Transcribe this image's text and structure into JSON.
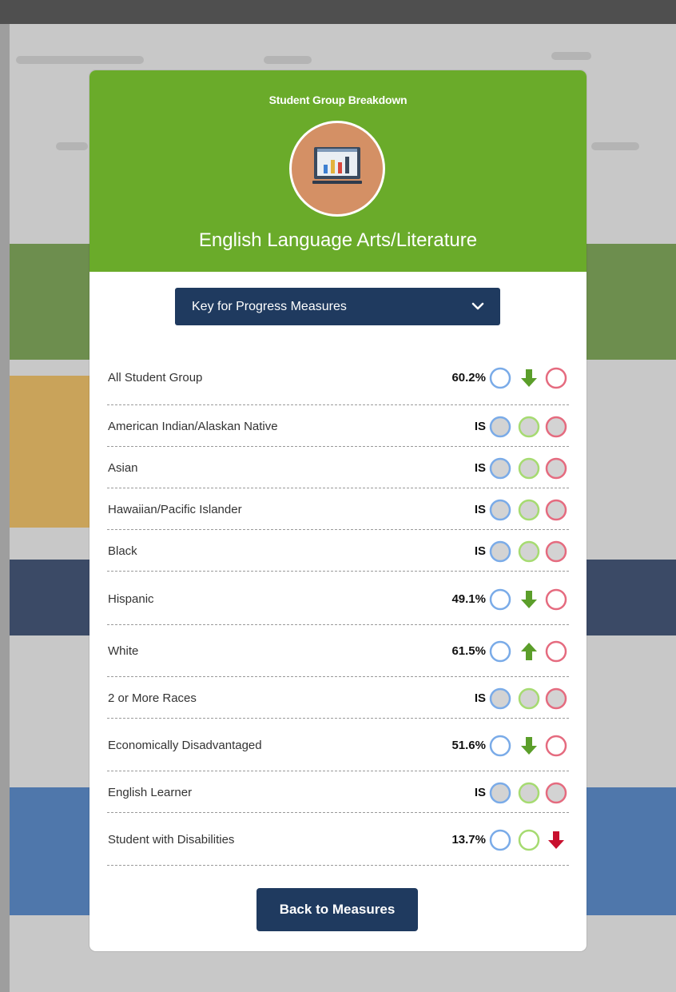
{
  "modal": {
    "title": "Student Group Breakdown",
    "subject": "English Language Arts/Literature",
    "subject_icon": "chart-monitor-icon",
    "key_dropdown_label": "Key for Progress Measures",
    "back_button_label": "Back to Measures"
  },
  "colors": {
    "header_green": "#6aab2a",
    "navy": "#1f3a5f",
    "circle_blue": "#7aabe8",
    "circle_green": "#a6db71",
    "circle_red": "#e56b7f",
    "arrow_green": "#5b9e2a",
    "arrow_red": "#c8102e"
  },
  "groups": [
    {
      "label": "All Student Group",
      "value": "60.2%",
      "indicators": [
        "blue-ring",
        "green-arrow-down",
        "red-ring"
      ]
    },
    {
      "label": "American Indian/Alaskan Native",
      "value": "IS",
      "indicators": [
        "blue-filled",
        "green-filled",
        "red-filled"
      ]
    },
    {
      "label": "Asian",
      "value": "IS",
      "indicators": [
        "blue-filled",
        "green-filled",
        "red-filled"
      ]
    },
    {
      "label": "Hawaiian/Pacific Islander",
      "value": "IS",
      "indicators": [
        "blue-filled",
        "green-filled",
        "red-filled"
      ]
    },
    {
      "label": "Black",
      "value": "IS",
      "indicators": [
        "blue-filled",
        "green-filled",
        "red-filled"
      ]
    },
    {
      "label": "Hispanic",
      "value": "49.1%",
      "indicators": [
        "blue-ring",
        "green-arrow-down",
        "red-ring"
      ]
    },
    {
      "label": "White",
      "value": "61.5%",
      "indicators": [
        "blue-ring",
        "green-arrow-up",
        "red-ring"
      ]
    },
    {
      "label": "2 or More Races",
      "value": "IS",
      "indicators": [
        "blue-filled",
        "green-filled",
        "red-filled"
      ]
    },
    {
      "label": "Economically Disadvantaged",
      "value": "51.6%",
      "indicators": [
        "blue-ring",
        "green-arrow-down",
        "red-ring"
      ]
    },
    {
      "label": "English Learner",
      "value": "IS",
      "indicators": [
        "blue-filled",
        "green-filled",
        "red-filled"
      ]
    },
    {
      "label": "Student with Disabilities",
      "value": "13.7%",
      "indicators": [
        "blue-ring",
        "green-ring",
        "red-arrow-down"
      ]
    }
  ]
}
